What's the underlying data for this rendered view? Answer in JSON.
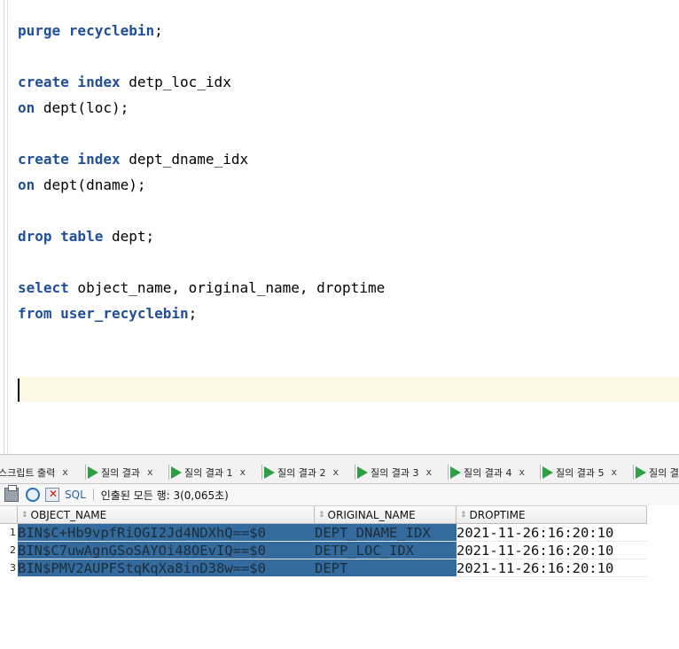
{
  "editor": {
    "lines": [
      {
        "kw": "purge recyclebin",
        "rest": ";"
      },
      {
        "kw": "",
        "rest": ""
      },
      {
        "kw": "create index",
        "rest": " detp_loc_idx"
      },
      {
        "kw": "on",
        "rest": " dept(loc);"
      },
      {
        "kw": "",
        "rest": ""
      },
      {
        "kw": "create index",
        "rest": " dept_dname_idx"
      },
      {
        "kw": "on",
        "rest": " dept(dname);"
      },
      {
        "kw": "",
        "rest": ""
      },
      {
        "kw": "drop table",
        "rest": " dept;"
      },
      {
        "kw": "",
        "rest": ""
      },
      {
        "kw": "select",
        "rest": " object_name, original_name, droptime"
      },
      {
        "kw": "from user_recyclebin",
        "rest": ";"
      }
    ]
  },
  "tabs": [
    {
      "label": "스크립트 출력",
      "close": "x",
      "icon": "none"
    },
    {
      "label": "질의 결과",
      "close": "x",
      "icon": "green-play-icon"
    },
    {
      "label": "질의 결과 1",
      "close": "x",
      "icon": "green-play-icon"
    },
    {
      "label": "질의 결과 2",
      "close": "x",
      "icon": "green-play-icon"
    },
    {
      "label": "질의 결과 3",
      "close": "x",
      "icon": "green-play-icon"
    },
    {
      "label": "질의 결과 4",
      "close": "x",
      "icon": "green-play-icon"
    },
    {
      "label": "질의 결과 5",
      "close": "x",
      "icon": "green-play-icon"
    },
    {
      "label": "질의 결",
      "close": "",
      "icon": "green-play-icon"
    }
  ],
  "toolbar": {
    "icons": [
      "print-icon",
      "refresh-icon",
      "clear-icon"
    ],
    "sql_label": "SQL",
    "fetch_message": "인출된 모든 행: 3(0,065초)"
  },
  "grid": {
    "columns": [
      "OBJECT_NAME",
      "ORIGINAL_NAME",
      "DROPTIME"
    ],
    "rows": [
      {
        "num": "1",
        "object_name": "BIN$C+Hb9vpfRiOGI2Jd4NDXhQ==$0",
        "original_name": "DEPT_DNAME_IDX",
        "droptime": "2021-11-26:16:20:10"
      },
      {
        "num": "2",
        "object_name": "BIN$C7uwAgnGSoSAYOi48OEvIQ==$0",
        "original_name": "DETP_LOC_IDX",
        "droptime": "2021-11-26:16:20:10"
      },
      {
        "num": "3",
        "object_name": "BIN$PMV2AUPFStqKqXa8inD38w==$0",
        "original_name": "DEPT",
        "droptime": "2021-11-26:16:20:10"
      }
    ]
  },
  "colors": {
    "keyword": "#1f4e9a",
    "selection": "#336b9e",
    "current_line": "#fdf7e3",
    "play_icon": "#2ea043"
  }
}
